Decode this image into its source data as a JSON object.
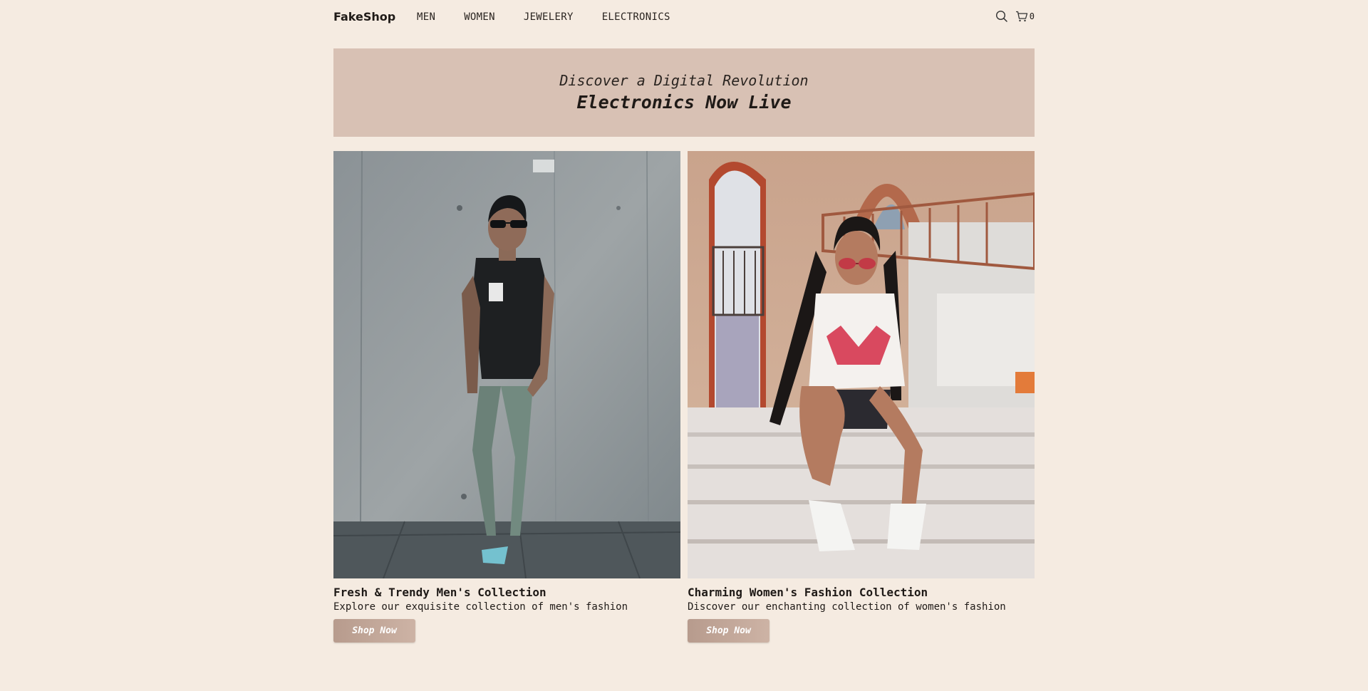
{
  "header": {
    "logo": "FakeShop",
    "nav": [
      "MEN",
      "WOMEN",
      "JEWELERY",
      "ELECTRONICS"
    ],
    "search_icon": "search-icon",
    "cart_icon": "cart-icon",
    "cart_count": "0"
  },
  "banner": {
    "subtitle": "Discover a Digital Revolution",
    "title": "Electronics Now Live",
    "background": "#d8c1b4"
  },
  "collections": [
    {
      "title": "Fresh & Trendy Men's Collection",
      "description": "Explore our exquisite collection of men's fashion",
      "button": "Shop Now"
    },
    {
      "title": "Charming Women's Fashion Collection",
      "description": "Discover our enchanting collection of women's fashion",
      "button": "Shop Now"
    }
  ],
  "colors": {
    "page_background": "#f5ebe1",
    "button": "#c2a798",
    "text": "#1f1a17"
  }
}
